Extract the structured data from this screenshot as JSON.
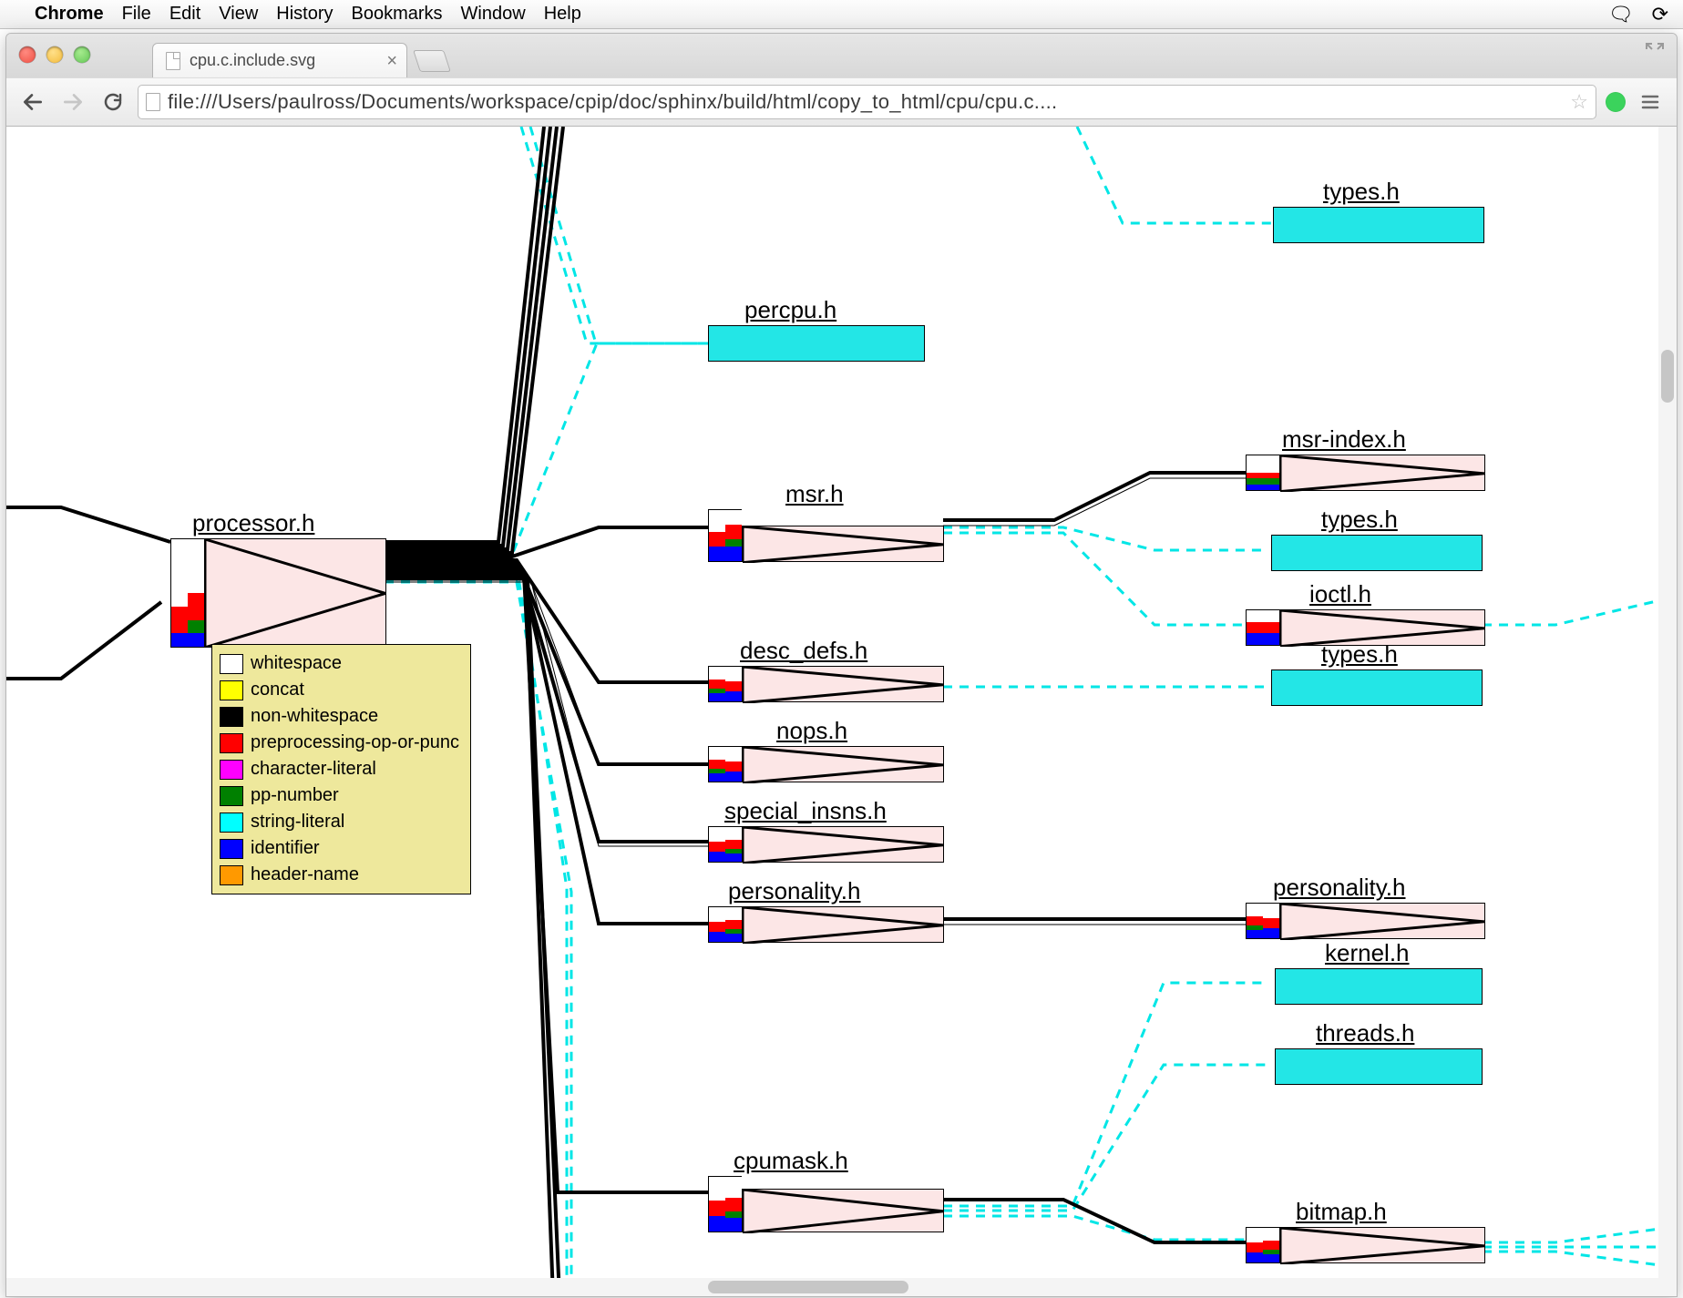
{
  "menubar": {
    "app_name": "Chrome",
    "items": [
      "File",
      "Edit",
      "View",
      "History",
      "Bookmarks",
      "Window",
      "Help"
    ]
  },
  "tab": {
    "title": "cpu.c.include.svg"
  },
  "toolbar": {
    "url": "file:///Users/paulross/Documents/workspace/cpip/doc/sphinx/build/html/copy_to_html/cpu/cpu.c...."
  },
  "legend": {
    "items": [
      {
        "color": "#ffffff",
        "label": "whitespace"
      },
      {
        "color": "#ffff00",
        "label": "concat"
      },
      {
        "color": "#000000",
        "label": "non-whitespace"
      },
      {
        "color": "#ff0000",
        "label": "preprocessing-op-or-punc"
      },
      {
        "color": "#ff00ff",
        "label": "character-literal"
      },
      {
        "color": "#008000",
        "label": "pp-number"
      },
      {
        "color": "#00ffff",
        "label": "string-literal"
      },
      {
        "color": "#0000ff",
        "label": "identifier"
      },
      {
        "color": "#ff9900",
        "label": "header-name"
      }
    ]
  },
  "nodes": {
    "processor": {
      "label": "processor.h"
    },
    "percpu": {
      "label": "percpu.h"
    },
    "types1": {
      "label": "types.h"
    },
    "msr": {
      "label": "msr.h"
    },
    "msr_index": {
      "label": "msr-index.h"
    },
    "types2": {
      "label": "types.h"
    },
    "ioctl": {
      "label": "ioctl.h"
    },
    "desc_defs": {
      "label": "desc_defs.h"
    },
    "types3": {
      "label": "types.h"
    },
    "nops": {
      "label": "nops.h"
    },
    "special_insns": {
      "label": "special_insns.h"
    },
    "personality": {
      "label": "personality.h"
    },
    "personality2": {
      "label": "personality.h"
    },
    "kernel": {
      "label": "kernel.h"
    },
    "threads": {
      "label": "threads.h"
    },
    "cpumask": {
      "label": "cpumask.h"
    },
    "bitmap": {
      "label": "bitmap.h"
    }
  }
}
